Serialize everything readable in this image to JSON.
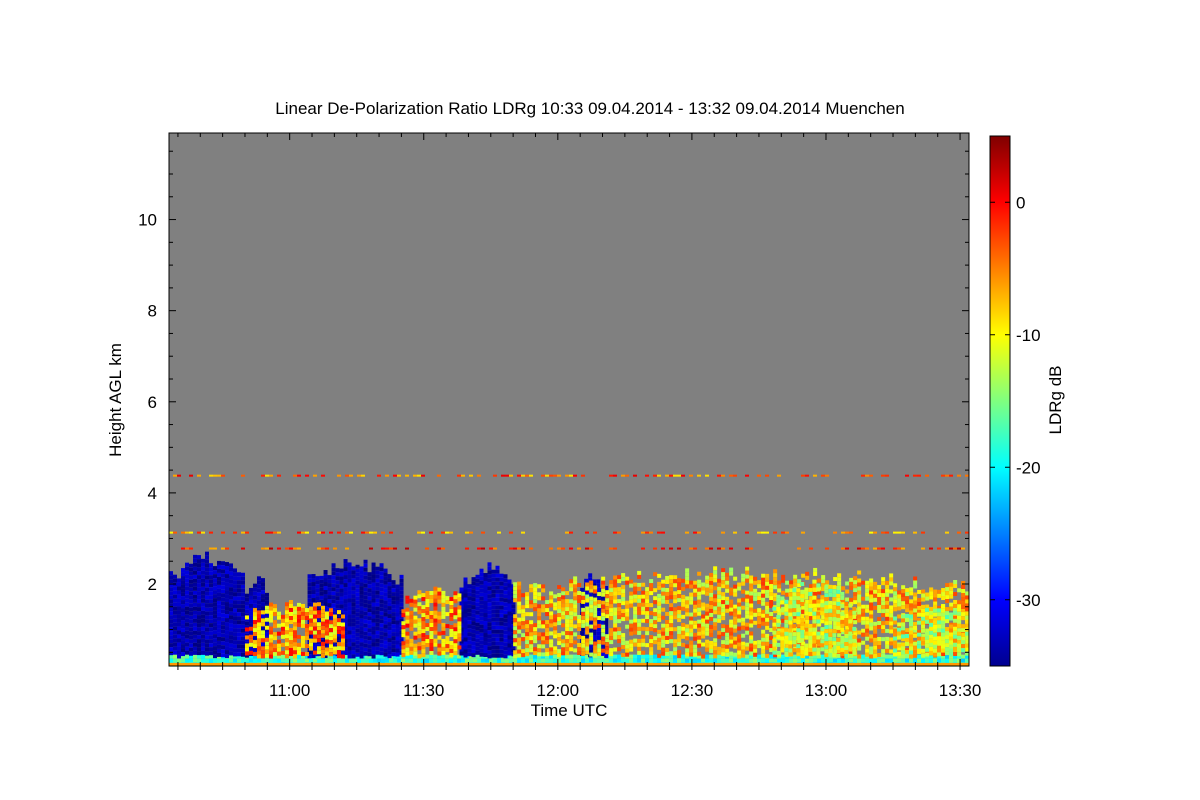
{
  "chart_data": {
    "type": "heatmap",
    "title": "Linear De-Polarization Ratio LDRg   10:33 09.04.2014 - 13:32 09.04.2014 Muenchen",
    "xlabel": "Time UTC",
    "ylabel": "Height AGL km",
    "xlim": [
      "10:33",
      "13:32"
    ],
    "ylim": [
      0.2,
      11.9
    ],
    "x_ticks": [
      "11:00",
      "11:30",
      "12:00",
      "12:30",
      "13:00",
      "13:30"
    ],
    "y_ticks": [
      "2",
      "4",
      "6",
      "8",
      "10"
    ],
    "colorbar": {
      "label": "LDRg dB",
      "range": [
        -35,
        5
      ],
      "ticks": [
        "0",
        "-10",
        "-20",
        "-30"
      ],
      "colormap": "jet"
    },
    "background_color": "#808080",
    "structures": [
      {
        "start": "10:33",
        "end": "10:50",
        "top_km": 2.6,
        "ldr_db": -33
      },
      {
        "start": "10:50",
        "end": "10:55",
        "top_km": 2.2,
        "ldr_db": -33
      },
      {
        "start": "11:04",
        "end": "11:25",
        "top_km": 2.5,
        "ldr_db": -33
      },
      {
        "start": "11:38",
        "end": "11:50",
        "top_km": 2.4,
        "ldr_db": -33
      },
      {
        "start": "12:05",
        "end": "12:11",
        "top_km": 2.2,
        "ldr_db": -33
      },
      {
        "start": "10:50",
        "end": "11:12",
        "top_km": 1.6,
        "ldr_db": -6
      },
      {
        "start": "11:25",
        "end": "11:38",
        "top_km": 2.0,
        "ldr_db": -6
      },
      {
        "start": "11:50",
        "end": "13:32",
        "top_km": 2.3,
        "ldr_db": -8
      },
      {
        "start": "12:48",
        "end": "13:06",
        "top_km": 2.0,
        "ldr_db": -11
      },
      {
        "start": "13:15",
        "end": "13:32",
        "top_km": 1.6,
        "ldr_db": -11
      }
    ],
    "layers": [
      {
        "height_km": 3.15,
        "ldr_db": -5
      },
      {
        "height_km": 2.8,
        "ldr_db": -2
      },
      {
        "height_km": 4.4,
        "ldr_db": -4
      }
    ]
  },
  "colors": {
    "background": "#808080",
    "axis": "#000000"
  }
}
